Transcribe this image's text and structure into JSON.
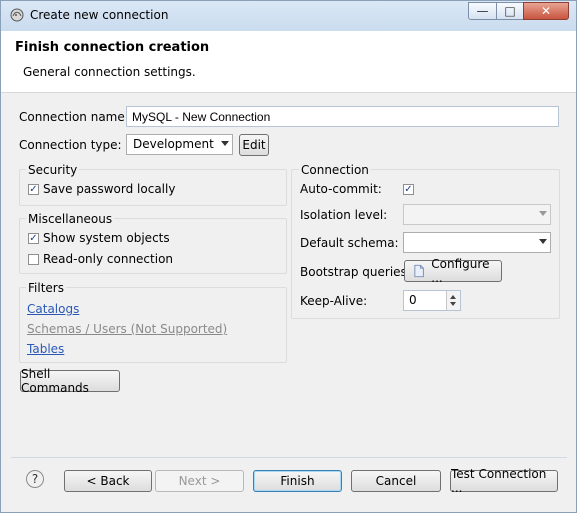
{
  "window": {
    "title": "Create new connection",
    "controls": {
      "minimize": "—",
      "maximize": "□",
      "close": "✕"
    }
  },
  "banner": {
    "title": "Finish connection creation",
    "subtitle": "General connection settings."
  },
  "form": {
    "connection_name_label": "Connection name:",
    "connection_name_value": "MySQL - New Connection",
    "connection_type_label": "Connection type:",
    "connection_type_value": "Development",
    "edit_button": "Edit"
  },
  "security": {
    "title": "Security",
    "save_password_label": "Save password locally",
    "save_password_checked": true
  },
  "misc": {
    "title": "Miscellaneous",
    "show_system_objects_label": "Show system objects",
    "show_system_objects_checked": true,
    "read_only_label": "Read-only connection",
    "read_only_checked": false
  },
  "filters": {
    "title": "Filters",
    "catalogs": "Catalogs",
    "schemas_users": "Schemas / Users (Not Supported)",
    "tables": "Tables"
  },
  "shell_commands_button": "Shell Commands",
  "connection_group": {
    "title": "Connection",
    "auto_commit_label": "Auto-commit:",
    "auto_commit_checked": true,
    "isolation_level_label": "Isolation level:",
    "isolation_level_value": "",
    "default_schema_label": "Default schema:",
    "default_schema_value": "",
    "bootstrap_queries_label": "Bootstrap queries:",
    "configure_button": "Configure ...",
    "keep_alive_label": "Keep-Alive:",
    "keep_alive_value": "0"
  },
  "footer": {
    "help_icon": "?",
    "back_button": "< Back",
    "next_button": "Next >",
    "finish_button": "Finish",
    "cancel_button": "Cancel",
    "test_connection_button": "Test Connection ..."
  },
  "colors": {
    "title_bar": "#dbe8f6",
    "link": "#2a58b7",
    "close_button": "#c8553f"
  }
}
